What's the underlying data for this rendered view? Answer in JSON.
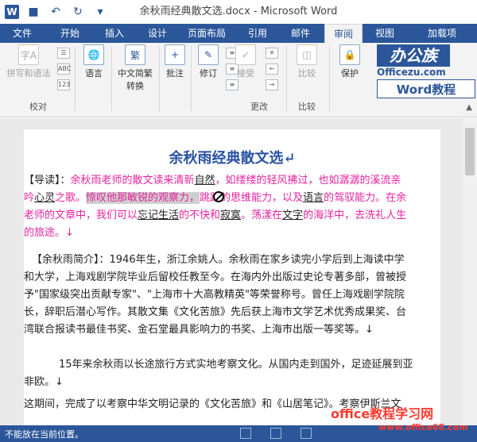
{
  "window": {
    "title": "余秋雨经典散文选.docx - Microsoft Word",
    "app_logo": "W"
  },
  "tabs": [
    "文件",
    "开始",
    "插入",
    "设计",
    "页面布局",
    "引用",
    "邮件",
    "审阅",
    "视图",
    "加载项"
  ],
  "active_tab": "审阅",
  "ribbon": {
    "spelling": "拼写和语法",
    "language": "语言",
    "chinese_convert_line1": "中文简繁",
    "chinese_convert_line2": "转换",
    "comment": "批注",
    "revision": "修订",
    "accept": "接受",
    "compare": "比较",
    "protect": "保护",
    "group_proofing": "校对",
    "group_changes": "更改",
    "group_compare": "比较",
    "small_abc": "ABC",
    "small_123": "123"
  },
  "brand": {
    "logo": "办公族",
    "site": "Officezu.com",
    "tagline": "Word教程"
  },
  "document": {
    "title": "余秋雨经典散文选↵",
    "intro_label": "【导读】：",
    "p1_l1": "余秋雨老师的散文读来清新",
    "p1_l1_u": "自然",
    "p1_l1_b": "，如缕缕的轻风拂过，也如潺潺的溪流亲",
    "p1_l2_a": "吟",
    "p1_l2_u": "心灵",
    "p1_l2_b": "之歌。",
    "p1_l2_sel": "惊叹他那敏锐的观察力，",
    "p1_l2_c": "跳跃的思维能力，以及",
    "p1_l2_u2": "语言",
    "p1_l2_d": "的驾驭能力。在余",
    "p1_l3_a": "老师的文章中，我们可以",
    "p1_l3_u": "忘记生活",
    "p1_l3_b": "的不快和",
    "p1_l3_u2": "寂寞",
    "p1_l3_c": "。荡漾在",
    "p1_l3_u3": "文字",
    "p1_l3_d": "的海洋中，去洗礼人生",
    "p1_l4": "的旅途。↓",
    "bio_l1": "【余秋雨简介】：1946年生，浙江余姚人。余秋雨在家乡读完小学后到上海读中学",
    "bio_l2": "和大学，上海戏剧学院毕业后留校任教至今。在海内外出版过史论专著多部，曾被授",
    "bio_l3": "予\"国家级突出贡献专家\"、\"上海市十大高教精英\"等荣誉称号。曾任上海戏剧学院院",
    "bio_l4": "长，辞职后潜心写作。其散文集《文化苦旅》先后获上海市文学艺术优秀成果奖、台",
    "bio_l5": "湾联合报读书最佳书奖、金石堂最具影响力的书奖、上海市出版一等奖等。↓",
    "p3_l1": "15年来余秋雨以长途旅行方式实地考察文化。从国内走到国外，足迹延展到亚",
    "p3_l2": "非欧。↓",
    "p4_l1": "这期间，完成了以考察中华文明记录的《文化苦旅》和《山居笔记》。考察伊斯兰文"
  },
  "status": {
    "message": "不能放在当前位置。"
  },
  "watermark": {
    "main": "office教程学习网",
    "url": "www.office68.com"
  },
  "colors": {
    "accent": "#2b579a",
    "highlight_text": "#e6229e",
    "title_text": "#2952a3"
  }
}
